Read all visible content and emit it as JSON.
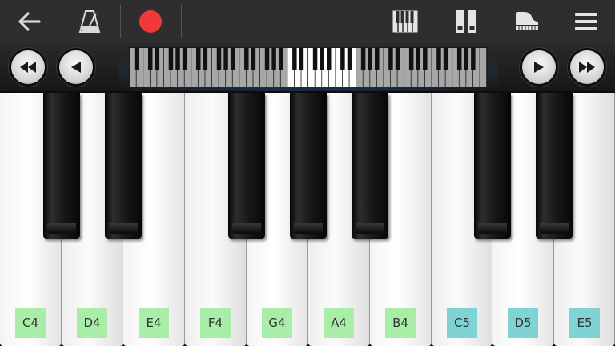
{
  "colors": {
    "toolbar_bg": "#2e2e2e",
    "record": "#f03a3a",
    "label_octave4": "#a8eea8",
    "label_octave5": "#7fd3d3",
    "viewport_glow": "#1e4c8c"
  },
  "toolbar": {
    "icons": [
      "back-arrow-icon",
      "metronome-icon",
      "record-icon",
      "keyboard-mode-icon",
      "dual-keyboard-icon",
      "grand-piano-icon",
      "menu-icon"
    ]
  },
  "navigator": {
    "buttons": [
      "fast-rewind-icon",
      "rewind-icon",
      "forward-icon",
      "fast-forward-icon"
    ],
    "total_white_keys": 52,
    "visible_start_white_key": 23,
    "visible_white_keys": 10
  },
  "keyboard": {
    "white_keys": [
      {
        "label": "C4",
        "octave": 4
      },
      {
        "label": "D4",
        "octave": 4
      },
      {
        "label": "E4",
        "octave": 4
      },
      {
        "label": "F4",
        "octave": 4
      },
      {
        "label": "G4",
        "octave": 4
      },
      {
        "label": "A4",
        "octave": 4
      },
      {
        "label": "B4",
        "octave": 4
      },
      {
        "label": "C5",
        "octave": 5
      },
      {
        "label": "D5",
        "octave": 5
      },
      {
        "label": "E5",
        "octave": 5
      }
    ]
  }
}
